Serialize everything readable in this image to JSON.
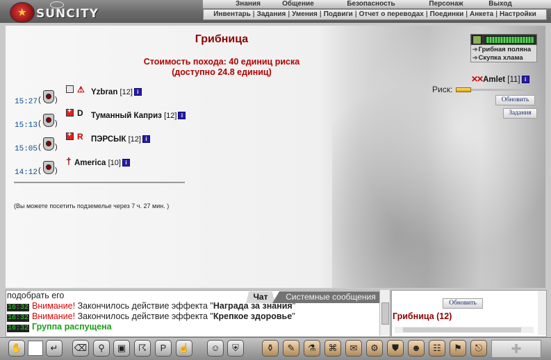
{
  "header": {
    "brand": "SUNCITY",
    "menu": [
      "Знания",
      "Общение",
      "Безопасность",
      "Персонаж",
      "Выход"
    ],
    "submenu": [
      "Инвентарь",
      "Задания",
      "Умения",
      "Подвиги",
      "Отчет о переводах",
      "Поединки",
      "Анкета",
      "Настройки"
    ]
  },
  "location": {
    "title": "Грибница",
    "cost_line1": "Стоимость похода: 40 единиц риска",
    "cost_line2": "(доступно 24.8 единиц)",
    "links": [
      "Грибная поляна",
      "Скупка хлама"
    ],
    "dungeon_note": "(Вы можете посетить подземелье через 7 ч. 27 мин. )"
  },
  "players": [
    {
      "time": "15:27",
      "name": "Yzbran",
      "level": "[12]",
      "clan": "gray",
      "tag": "⚠"
    },
    {
      "time": "15:13",
      "name": "Туманный Каприз",
      "level": "[12]",
      "clan": "red",
      "tag": "D"
    },
    {
      "time": "15:05",
      "name": "ПЭРСЫК",
      "level": "[12]",
      "clan": "red",
      "tag": "R"
    },
    {
      "time": "14:12",
      "name": "America",
      "level": "[10]",
      "clan": "none",
      "tag": "†"
    }
  ],
  "me": {
    "name": "Amlet",
    "level": "[11]",
    "x_mark": "✕✕"
  },
  "risk": {
    "label": "Риск:",
    "value": 0.22
  },
  "buttons": {
    "refresh": "Обновить",
    "tasks": "Задания",
    "online_refresh": "Обновить"
  },
  "chat": {
    "tabs": [
      "Чат",
      "Системные сообщения"
    ],
    "lines": [
      {
        "ts": "",
        "text": "подобрать его"
      },
      {
        "ts": "16:32",
        "prefix": "Внимание!",
        "text": " Закончилось действие эффекта \"",
        "bold": "Награда за знания",
        "suffix": "\""
      },
      {
        "ts": "16:32",
        "prefix": "Внимание!",
        "text": " Закончилось действие эффекта \"",
        "bold": "Крепкое здоровье",
        "suffix": "\""
      },
      {
        "ts": "16:32",
        "green": "Группа распущена"
      }
    ]
  },
  "online": {
    "title": "Грибница (12)"
  },
  "colors": {
    "title": "#8b0000",
    "cost": "#b00000",
    "timestamp": "#0a4a8c",
    "risk_bar": "#e0a000"
  },
  "toolbar_icons": [
    "hand-icon",
    "input",
    "enter-icon",
    "eraser-icon",
    "filter-icon",
    "save-icon",
    "dance-icon",
    "pl-icon",
    "hand-raise-icon",
    "smile-icon",
    "clan-icon",
    "bag-icon",
    "pen-icon",
    "potion-icon",
    "map-icon",
    "scroll-icon",
    "tools-icon",
    "armor-icon",
    "friend-icon",
    "group-icon",
    "flag-icon",
    "exit-icon",
    "gear-icon"
  ]
}
